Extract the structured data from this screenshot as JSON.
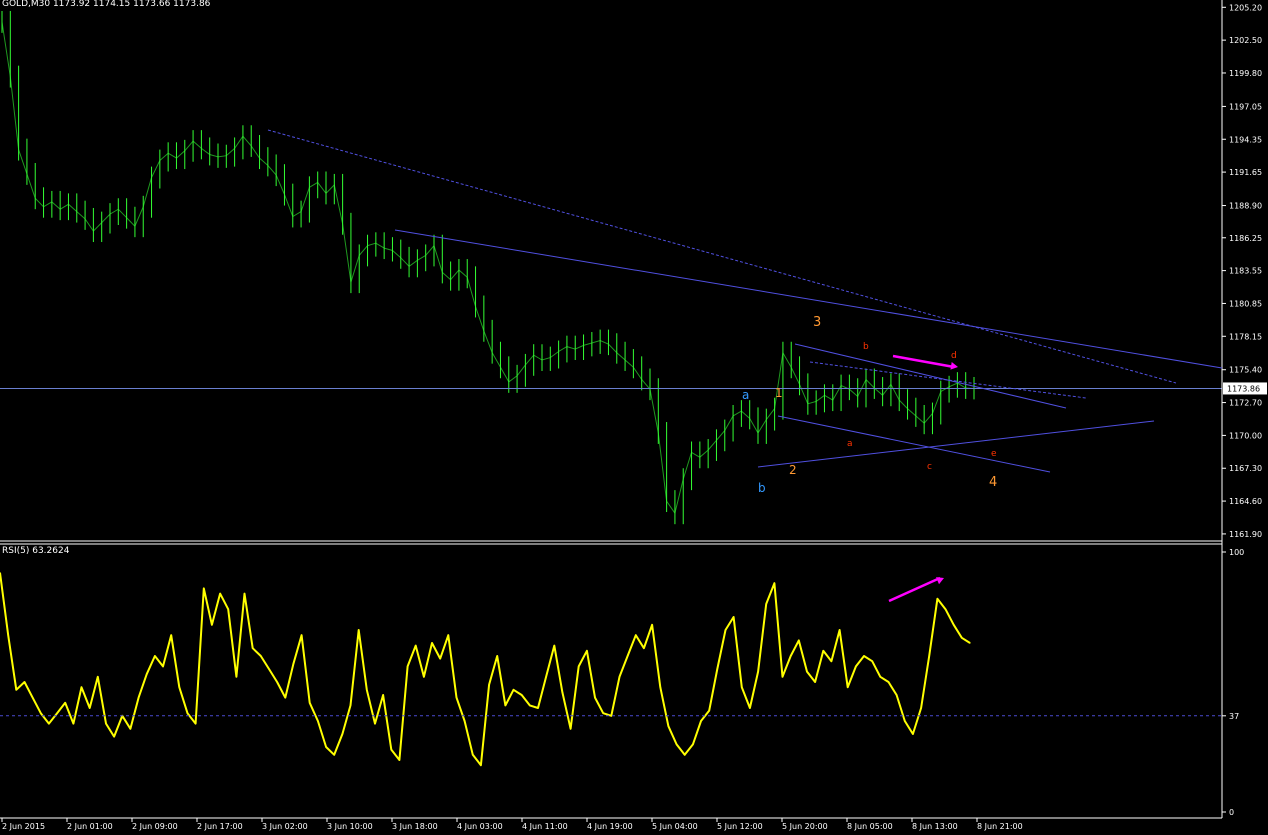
{
  "window": {
    "symbol_header": "GOLD,M30  1173.92 1174.15 1173.66 1173.86",
    "indicator_header": "RSI(5) 63.2624"
  },
  "colors": {
    "background": "#000000",
    "candles": "#33ff33",
    "trendlines": "#5050e0",
    "rsi_line": "#ffff00",
    "arrow": "#ff00ff",
    "axis_text": "#ffffff",
    "price_tag_bg": "#ffffff"
  },
  "chart_data": [
    {
      "type": "line",
      "title": "GOLD,M30",
      "y_axis": {
        "ticks": [
          "1205.20",
          "1202.50",
          "1199.80",
          "1197.05",
          "1194.35",
          "1191.65",
          "1188.90",
          "1186.25",
          "1183.55",
          "1180.85",
          "1178.15",
          "1175.40",
          "1172.70",
          "1170.00",
          "1167.30",
          "1164.60",
          "1161.90"
        ],
        "ylim": [
          1161.4,
          1205.8
        ]
      },
      "x_axis": {
        "ticks": [
          "2 Jun 2015",
          "2 Jun 01:00",
          "2 Jun 09:00",
          "2 Jun 17:00",
          "3 Jun 02:00",
          "3 Jun 10:00",
          "3 Jun 18:00",
          "4 Jun 03:00",
          "4 Jun 11:00",
          "4 Jun 19:00",
          "5 Jun 04:00",
          "5 Jun 12:00",
          "5 Jun 20:00",
          "8 Jun 05:00",
          "8 Jun 13:00",
          "8 Jun 21:00"
        ]
      },
      "current_price": {
        "label": "1173.86",
        "value": 1173.86
      },
      "series": [
        {
          "name": "",
          "values": [
            1204.0,
            1199.5,
            1193.5,
            1191.5,
            1189.5,
            1188.8,
            1189.2,
            1188.6,
            1189.0,
            1188.4,
            1187.8,
            1186.8,
            1187.5,
            1188.2,
            1188.6,
            1187.9,
            1187.2,
            1188.8,
            1191.2,
            1192.6,
            1193.2,
            1192.8,
            1193.4,
            1194.2,
            1193.6,
            1193.1,
            1192.9,
            1193.0,
            1193.6,
            1194.6,
            1193.8,
            1192.8,
            1192.2,
            1191.4,
            1189.8,
            1188.0,
            1188.4,
            1190.4,
            1190.8,
            1189.9,
            1190.6,
            1187.4,
            1182.6,
            1184.8,
            1185.6,
            1185.8,
            1185.4,
            1185.2,
            1184.6,
            1183.9,
            1184.4,
            1184.8,
            1185.6,
            1183.4,
            1182.8,
            1183.6,
            1183.0,
            1180.6,
            1178.6,
            1176.8,
            1175.6,
            1174.4,
            1174.9,
            1175.8,
            1176.6,
            1176.2,
            1176.4,
            1176.9,
            1177.3,
            1177.1,
            1177.4,
            1177.6,
            1177.8,
            1177.5,
            1176.8,
            1176.2,
            1175.6,
            1174.6,
            1173.8,
            1170.2,
            1164.6,
            1163.6,
            1166.4,
            1168.6,
            1168.2,
            1168.8,
            1169.6,
            1170.4,
            1171.6,
            1172.0,
            1171.4,
            1170.2,
            1171.3,
            1172.2,
            1176.8,
            1175.6,
            1174.2,
            1172.6,
            1172.8,
            1173.3,
            1172.9,
            1174.1,
            1173.8,
            1173.2,
            1174.6,
            1173.9,
            1173.3,
            1174.2,
            1172.9,
            1172.2,
            1171.6,
            1171.0,
            1171.8,
            1173.6,
            1174.0,
            1174.3,
            1173.9,
            1173.86
          ]
        }
      ],
      "annotations": [
        {
          "text": "3",
          "color": "#ff9933"
        },
        {
          "text": "1",
          "color": "#ff9933"
        },
        {
          "text": "2",
          "color": "#ff9933"
        },
        {
          "text": "4",
          "color": "#ff9933"
        },
        {
          "text": "a",
          "color": "#3399ff"
        },
        {
          "text": "b",
          "color": "#3399ff"
        },
        {
          "text": "b",
          "color": "#ff3300"
        },
        {
          "text": "a",
          "color": "#ff3300"
        },
        {
          "text": "c",
          "color": "#ff3300"
        },
        {
          "text": "d",
          "color": "#ff3300"
        },
        {
          "text": "e",
          "color": "#ff3300"
        }
      ]
    },
    {
      "type": "line",
      "title": "RSI(5) 63.2624",
      "y_axis": {
        "ticks": [
          "100",
          "37",
          "0"
        ],
        "ylim": [
          0,
          100
        ]
      },
      "level": 37,
      "series": [
        {
          "name": "",
          "values": [
            92,
            68,
            47,
            50,
            44,
            38,
            34,
            38,
            42,
            34,
            48,
            40,
            52,
            34,
            29,
            37,
            32,
            44,
            53,
            60,
            56,
            68,
            48,
            38,
            34,
            86,
            72,
            84,
            78,
            52,
            84,
            63,
            60,
            55,
            50,
            44,
            57,
            68,
            42,
            35,
            25,
            22,
            30,
            41,
            70,
            47,
            34,
            45,
            24,
            20,
            56,
            64,
            52,
            65,
            59,
            68,
            44,
            35,
            22,
            18,
            49,
            60,
            41,
            47,
            45,
            41,
            40,
            52,
            64,
            46,
            32,
            56,
            62,
            44,
            38,
            37,
            52,
            60,
            68,
            63,
            72,
            48,
            33,
            26,
            22,
            26,
            35,
            39,
            55,
            70,
            75,
            48,
            40,
            54,
            80,
            88,
            52,
            60,
            66,
            54,
            50,
            62,
            58,
            70,
            48,
            56,
            60,
            58,
            52,
            50,
            45,
            35,
            30,
            40,
            60,
            82,
            78,
            72,
            67,
            65
          ]
        }
      ]
    }
  ]
}
